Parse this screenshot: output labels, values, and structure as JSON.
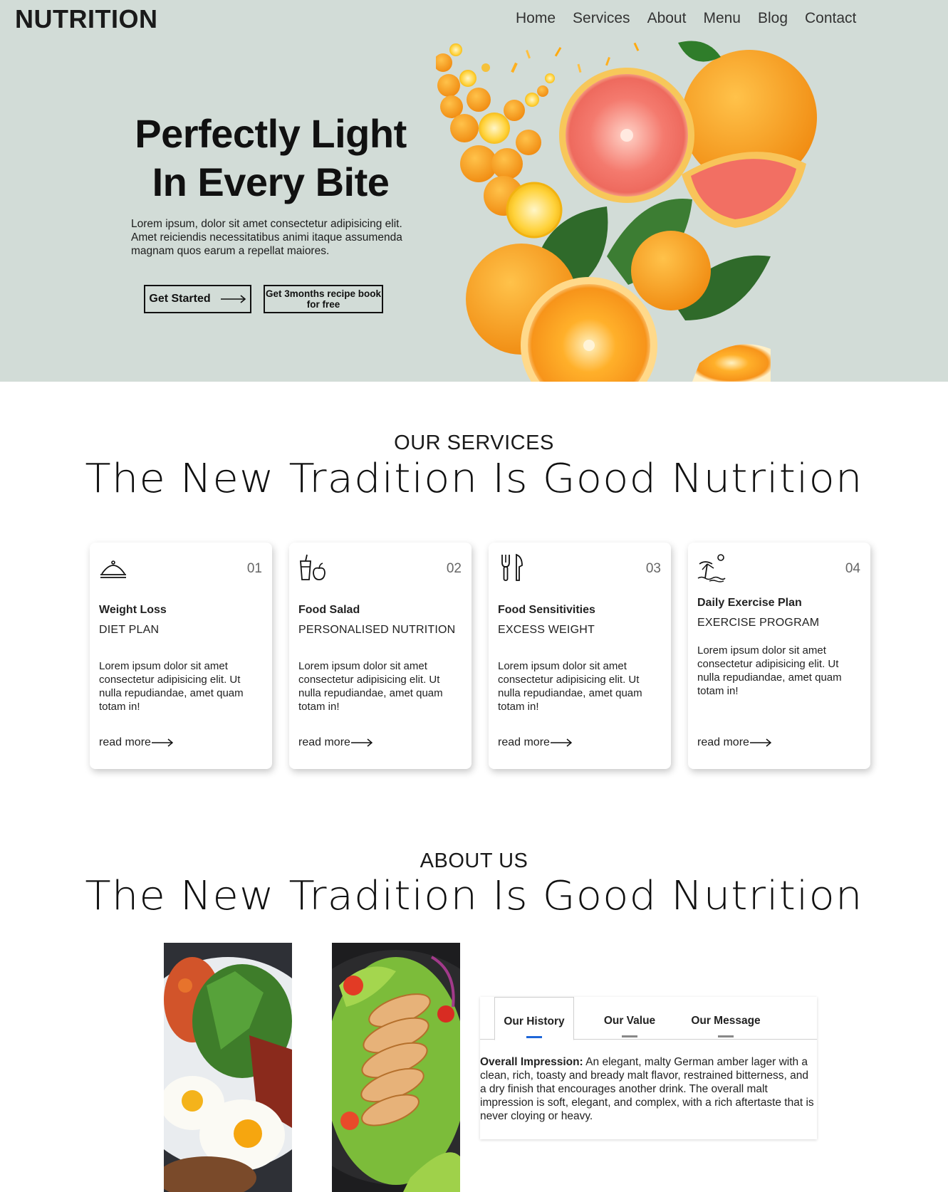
{
  "header": {
    "brand": "NUTRITION",
    "nav": [
      "Home",
      "Services",
      "About",
      "Menu",
      "Blog",
      "Contact"
    ]
  },
  "hero": {
    "title_line1": "Perfectly Light",
    "title_line2": "In Every Bite",
    "lead": "Lorem ipsum, dolor sit amet consectetur adipisicing elit. Amet reiciendis necessitatibus animi itaque assumenda magnam quos earum a repellat maiores.",
    "primary_button": "Get Started",
    "secondary_button": "Get 3months recipe book for free"
  },
  "services": {
    "kicker": "OUR SERVICES",
    "heading": "The New Tradition Is Good Nutrition",
    "cards": [
      {
        "icon": "food-cloche-icon",
        "number": "01",
        "title": "Weight Loss",
        "subtitle": "DIET PLAN",
        "text": "Lorem ipsum dolor sit amet consectetur adipisicing elit. Ut nulla repudiandae, amet quam totam in!",
        "link": "read more"
      },
      {
        "icon": "drink-apple-icon",
        "number": "02",
        "title": "Food Salad",
        "subtitle": "PERSONALISED NUTRITION",
        "text": "Lorem ipsum dolor sit amet consectetur adipisicing elit. Ut nulla repudiandae, amet quam totam in!",
        "link": "read more"
      },
      {
        "icon": "utensils-icon",
        "number": "03",
        "title": "Food Sensitivities",
        "subtitle": "EXCESS WEIGHT",
        "text": "Lorem ipsum dolor sit amet consectetur adipisicing elit. Ut nulla repudiandae, amet quam totam in!",
        "link": "read more"
      },
      {
        "icon": "beach-icon",
        "number": "04",
        "title": "Daily Exercise Plan",
        "subtitle": "EXERCISE PROGRAM",
        "text": "Lorem ipsum dolor sit amet consectetur adipisicing elit. Ut nulla repudiandae, amet quam totam in!",
        "link": "read more"
      }
    ]
  },
  "about": {
    "kicker": "ABOUT US",
    "heading": "The New Tradition Is Good Nutrition",
    "tabs": [
      "Our History",
      "Our Value",
      "Our Message"
    ],
    "active_tab": "Our History",
    "panel_label": "Overall Impression:",
    "panel_text": " An elegant, malty German amber lager with a clean, rich, toasty and bready malt flavor, restrained bitterness, and a dry finish that encourages another drink. The overall malt impression is soft, elegant, and complex, with a rich aftertaste that is never cloying or heavy."
  },
  "colors": {
    "hero_bg": "#d2dcd7",
    "active_tab_indicator": "#1e66d8",
    "inactive_tab_indicator": "#888888"
  }
}
